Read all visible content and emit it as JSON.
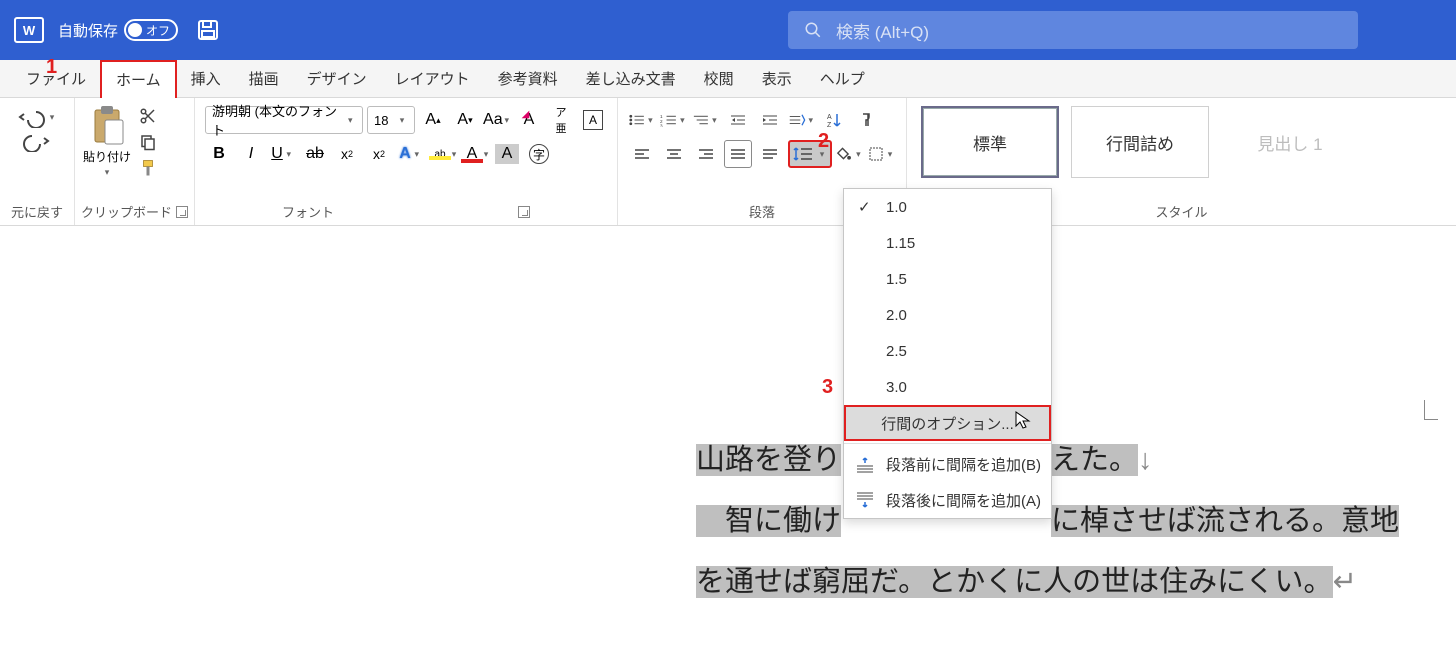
{
  "titlebar": {
    "autosave_label": "自動保存",
    "autosave_state": "オフ"
  },
  "search": {
    "placeholder": "検索 (Alt+Q)"
  },
  "tabs": {
    "file": "ファイル",
    "home": "ホーム",
    "insert": "挿入",
    "draw": "描画",
    "design": "デザイン",
    "layout": "レイアウト",
    "references": "参考資料",
    "mailings": "差し込み文書",
    "review": "校閲",
    "view": "表示",
    "help": "ヘルプ"
  },
  "ribbon": {
    "undo_label": "元に戻す",
    "clipboard_label": "クリップボード",
    "paste_label": "貼り付け",
    "font_label": "フォント",
    "font_name": "游明朝 (本文のフォント",
    "font_size": "18",
    "para_label": "段落",
    "style_label": "スタイル",
    "styles": {
      "normal": "標準",
      "nospace": "行間詰め",
      "h1": "見出し 1"
    }
  },
  "line_menu": {
    "o1": "1.0",
    "o2": "1.15",
    "o3": "1.5",
    "o4": "2.0",
    "o5": "2.5",
    "o6": "3.0",
    "options": "行間のオプション...",
    "before": "段落前に間隔を追加(B)",
    "after": "段落後に間隔を追加(A)"
  },
  "annotations": {
    "n1": "1",
    "n2": "2",
    "n3": "3"
  },
  "document": {
    "line1a": "山路を登り",
    "line1b": "えた。",
    "line2a": "　智に働け",
    "line2b": "に棹させば流される。意地",
    "line3": "を通せば窮屈だ。とかくに人の世は住みにくい。"
  }
}
